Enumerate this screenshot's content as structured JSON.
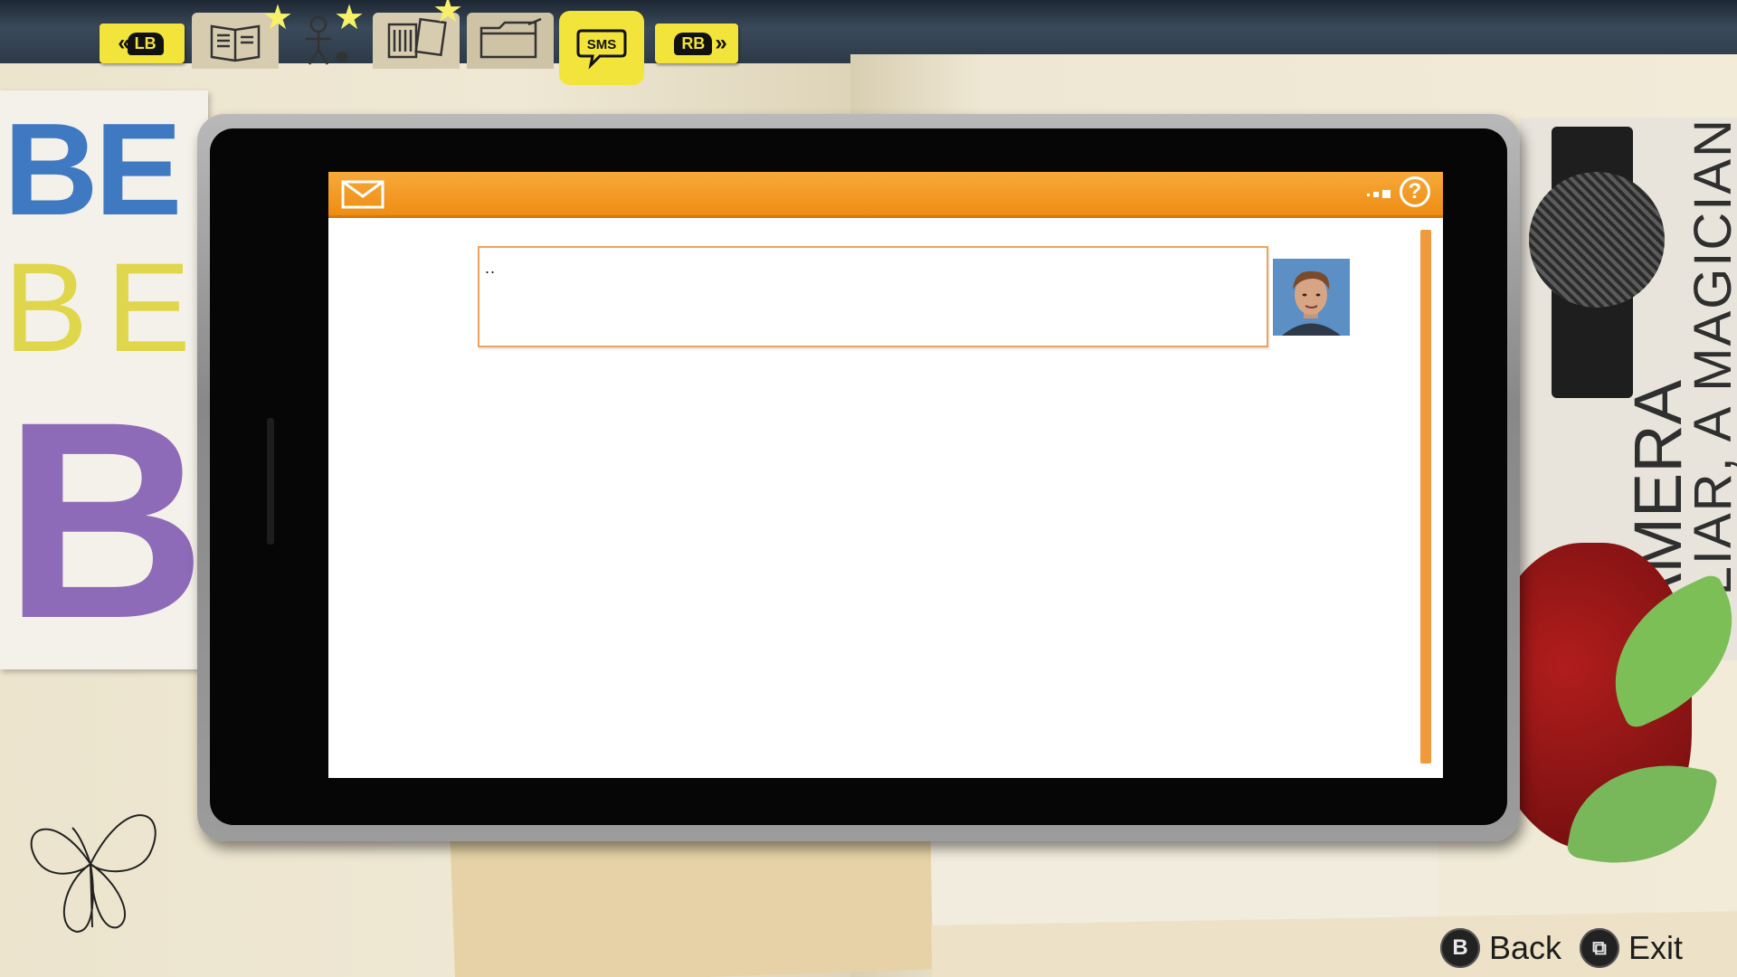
{
  "nav": {
    "prev_button": "LB",
    "next_button": "RB",
    "tabs": [
      {
        "name": "journal",
        "icon": "journal-icon"
      },
      {
        "name": "characters",
        "icon": "stick-figure-icon"
      },
      {
        "name": "photos",
        "icon": "photos-icon"
      },
      {
        "name": "collectibles",
        "icon": "folder-icon"
      },
      {
        "name": "sms",
        "label": "SMS",
        "active": true
      }
    ]
  },
  "background": {
    "letters": [
      "BE",
      "BE",
      "BI"
    ],
    "vertical_text_1": "LIAR, A MAGICIAN",
    "vertical_text_2": "CAMERA"
  },
  "phone": {
    "messages": [
      {
        "text": "..",
        "sender": "male-contact",
        "avatar": "avatar-portrait"
      }
    ],
    "accent_color": "#ee8d13"
  },
  "prompts": {
    "back": {
      "button": "B",
      "label": "Back"
    },
    "exit": {
      "button": "⧉",
      "label": "Exit"
    }
  }
}
